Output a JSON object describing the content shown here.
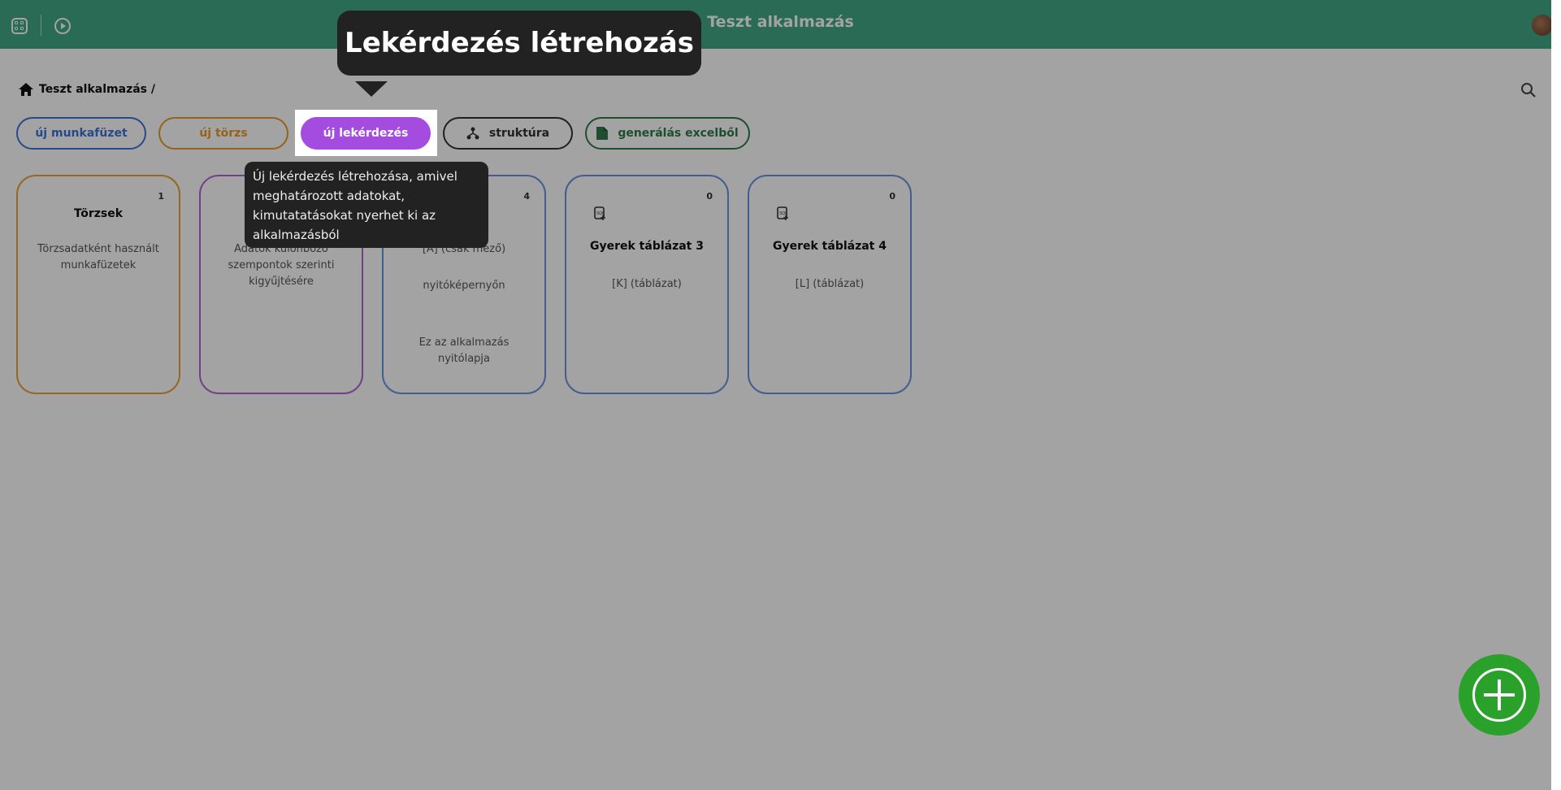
{
  "header": {
    "title": "Teszt alkalmazás",
    "icons": [
      "grid-icon",
      "play-icon",
      "avatar"
    ]
  },
  "breadcrumb": {
    "label": "Teszt alkalmazás /"
  },
  "toolbar": {
    "new_workbook": "új munkafüzet",
    "new_master": "új törzs",
    "new_query": "új lekérdezés",
    "structure": "struktúra",
    "excel": "generálás excelből"
  },
  "cards": [
    {
      "count": "1",
      "title": "Törzsek",
      "desc": "Törzsadatként használt munkafüzetek"
    },
    {
      "count": "",
      "title": "",
      "desc": "Adatok különböző szempontok szerinti kigyűjtésére"
    },
    {
      "count": "4",
      "title": "",
      "line1": "[A] (csak mező)",
      "line2": "nyitóképernyőn",
      "desc": "Ez az alkalmazás nyitólapja"
    },
    {
      "count": "0",
      "title": "Gyerek táblázat 3",
      "desc": "[K] (táblázat)"
    },
    {
      "count": "0",
      "title": "Gyerek táblázat 4",
      "desc": "[L] (táblázat)"
    }
  ],
  "tour": {
    "title": "Lekérdezés létrehozás",
    "text": "Új lekérdezés létrehozása, amivel meghatározott adatokat, kimutatatásokat nyerhet ki az alkalmazásból"
  },
  "colors": {
    "header": "#40a886",
    "workbook": "#3d72d6",
    "master": "#e89a2a",
    "query": "#a44be0",
    "excel": "#2f7a4a",
    "fab": "#2aa12a"
  }
}
